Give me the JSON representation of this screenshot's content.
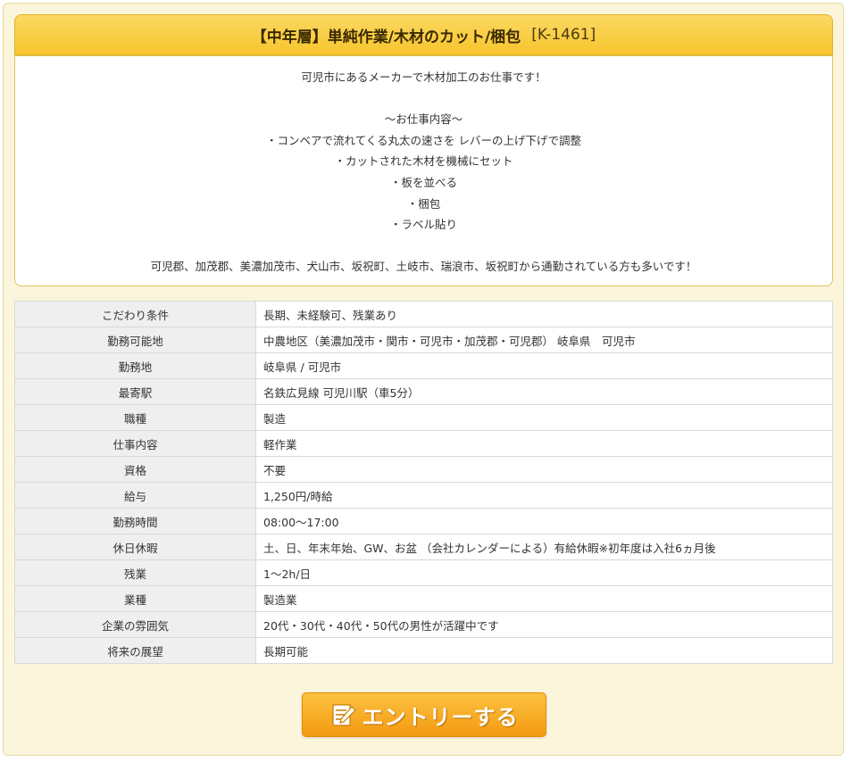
{
  "job": {
    "title": "【中年層】単純作業/木材のカット/梱包",
    "code": "[K-1461]"
  },
  "description": {
    "lines": [
      "可児市にあるメーカーで木材加工のお仕事です！",
      "",
      "～お仕事内容～",
      "・コンベアで流れてくる丸太の速さを レバーの上げ下げで調整",
      "・カットされた木材を機械にセット",
      "・板を並べる",
      "・梱包",
      "・ラベル貼り",
      "",
      "可児郡、加茂郡、美濃加茂市、犬山市、坂祝町、土岐市、瑞浪市、坂祝町から通勤されている方も多いです！"
    ]
  },
  "table": {
    "rows": [
      {
        "label": "こだわり条件",
        "value": "長期、未経験可、残業あり"
      },
      {
        "label": "勤務可能地",
        "value": "中農地区（美濃加茂市・関市・可児市・加茂郡・可児郡） 岐阜県　可児市"
      },
      {
        "label": "勤務地",
        "value": "岐阜県 / 可児市"
      },
      {
        "label": "最寄駅",
        "value": "名鉄広見線 可児川駅（車5分）"
      },
      {
        "label": "職種",
        "value": "製造"
      },
      {
        "label": "仕事内容",
        "value": "軽作業"
      },
      {
        "label": "資格",
        "value": "不要"
      },
      {
        "label": "給与",
        "value": "1,250円/時給"
      },
      {
        "label": "勤務時間",
        "value": "08:00～17:00"
      },
      {
        "label": "休日休暇",
        "value": "土、日、年末年始、GW、お盆 （会社カレンダーによる）有給休暇※初年度は入社6ヵ月後"
      },
      {
        "label": "残業",
        "value": "1～2h/日"
      },
      {
        "label": "業種",
        "value": "製造業"
      },
      {
        "label": "企業の雰囲気",
        "value": "20代・30代・40代・50代の男性が活躍中です"
      },
      {
        "label": "将来の展望",
        "value": "長期可能"
      }
    ]
  },
  "entry": {
    "label": "エントリーする",
    "icon": "pencil-form-icon"
  },
  "colors": {
    "title_bg": "#f7c52c",
    "panel_bg": "#fbf5dc",
    "label_bg": "#efefef",
    "button_bg": "#f39a10"
  }
}
